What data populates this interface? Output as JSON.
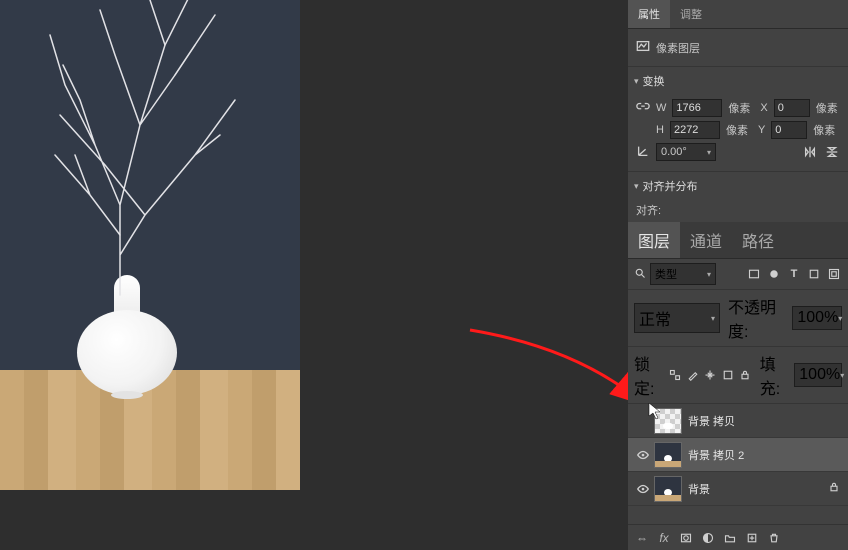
{
  "properties": {
    "tabs": [
      "属性",
      "调整"
    ],
    "active_tab": 0,
    "type_label": "像素图层",
    "transform_header": "变换",
    "w_label": "W",
    "w_value": "1766",
    "w_unit": "像素",
    "x_label": "X",
    "x_value": "0",
    "x_unit": "像素",
    "h_label": "H",
    "h_value": "2272",
    "h_unit": "像素",
    "y_label": "Y",
    "y_value": "0",
    "y_unit": "像素",
    "angle_value": "0.00°",
    "align_header": "对齐并分布",
    "align_label": "对齐:"
  },
  "layers_panel": {
    "tabs": [
      "图层",
      "通道",
      "路径"
    ],
    "active_tab": 0,
    "filter_kind": "类型",
    "blend_mode": "正常",
    "opacity_label": "不透明度:",
    "opacity_value": "100%",
    "lock_label": "锁定:",
    "fill_label": "填充:",
    "fill_value": "100%",
    "layers": [
      {
        "name": "背景 拷贝",
        "visible": false,
        "selected": false,
        "thumb": "checker",
        "locked": false
      },
      {
        "name": "背景 拷贝 2",
        "visible": true,
        "selected": true,
        "thumb": "image",
        "locked": false
      },
      {
        "name": "背景",
        "visible": true,
        "selected": false,
        "thumb": "image",
        "locked": true
      }
    ]
  }
}
